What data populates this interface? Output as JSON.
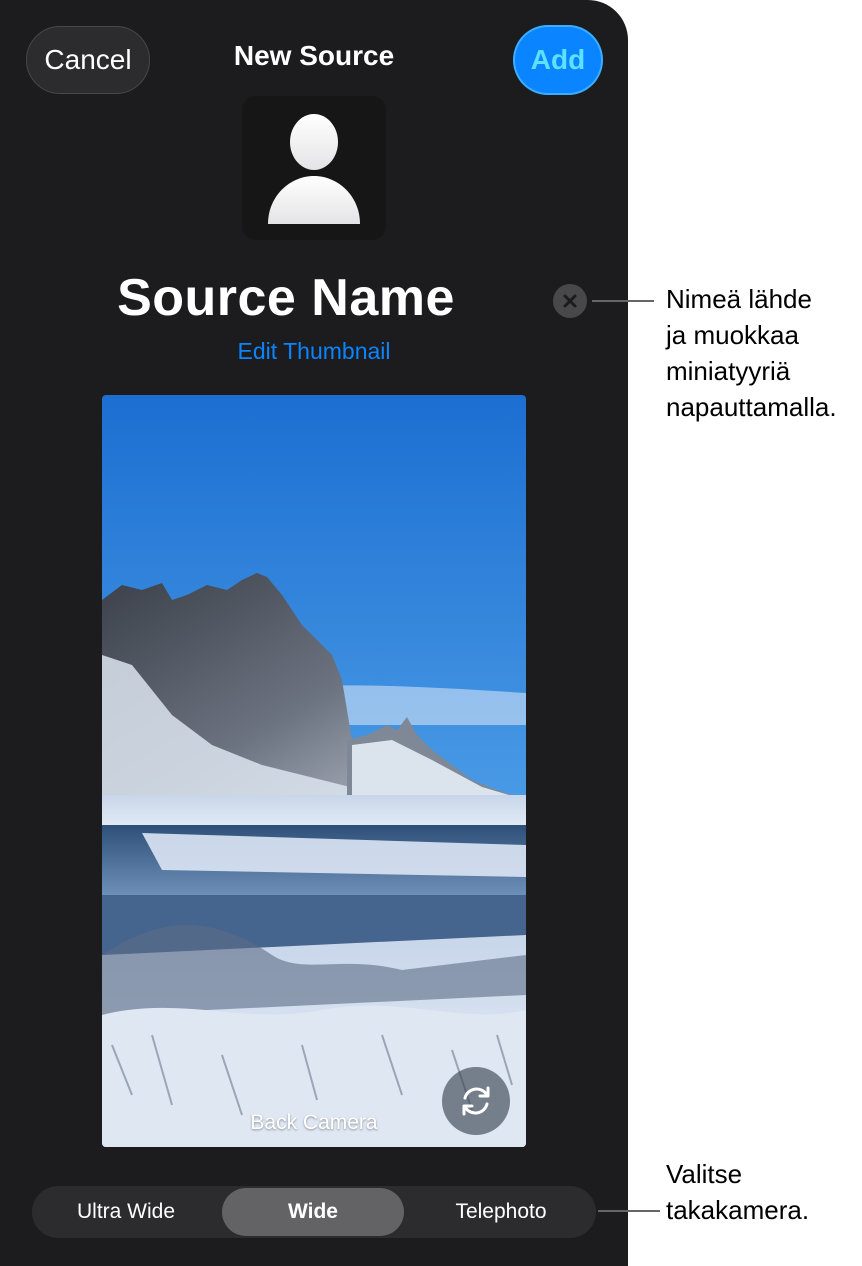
{
  "header": {
    "cancel_label": "Cancel",
    "title": "New Source",
    "add_label": "Add"
  },
  "source": {
    "name": "Source Name",
    "edit_thumbnail_label": "Edit Thumbnail"
  },
  "camera": {
    "label": "Back Camera"
  },
  "lens_selector": {
    "options": [
      "Ultra Wide",
      "Wide",
      "Telephoto"
    ],
    "selected": "Wide"
  },
  "annotations": {
    "name_callout": [
      "Nimeä lähde",
      "ja muokkaa",
      "miniatyyriä",
      "napauttamalla."
    ],
    "camera_callout": [
      "Valitse",
      "takakamera."
    ]
  },
  "colors": {
    "background": "#1c1c1e",
    "accent": "#0a84ff",
    "segment_selected": "#636366"
  },
  "icons": {
    "thumbnail": "person-icon",
    "clear": "clear-icon",
    "switch_camera": "switch-camera-icon"
  }
}
